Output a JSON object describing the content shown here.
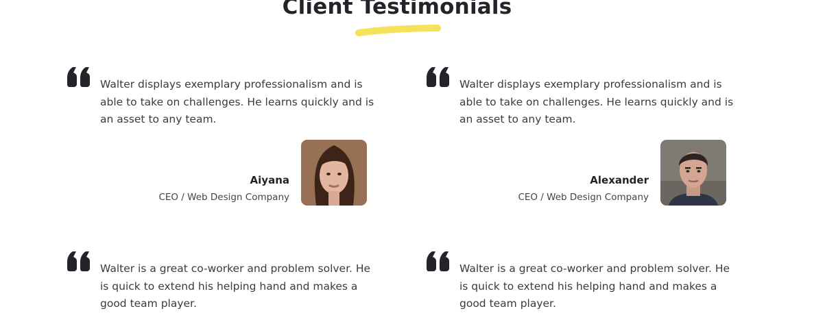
{
  "section": {
    "title": "Client Testimonials",
    "accent_color": "#f5e15a"
  },
  "testimonials": [
    {
      "text": "Walter displays exemplary professionalism and is able to take on challenges. He learns quickly and is an asset to any team.",
      "name": "Aiyana",
      "role": "CEO / Web Design Company",
      "avatar_icon": "woman-portrait"
    },
    {
      "text": "Walter displays exemplary professionalism and is able to take on challenges. He learns quickly and is an asset to any team.",
      "name": "Alexander",
      "role": "CEO / Web Design Company",
      "avatar_icon": "man-portrait"
    },
    {
      "text": "Walter is a great co-worker and problem solver. He is quick to extend his helping hand and makes a good team player."
    },
    {
      "text": "Walter is a great co-worker and problem solver. He is quick to extend his helping hand and makes a good team player."
    }
  ]
}
